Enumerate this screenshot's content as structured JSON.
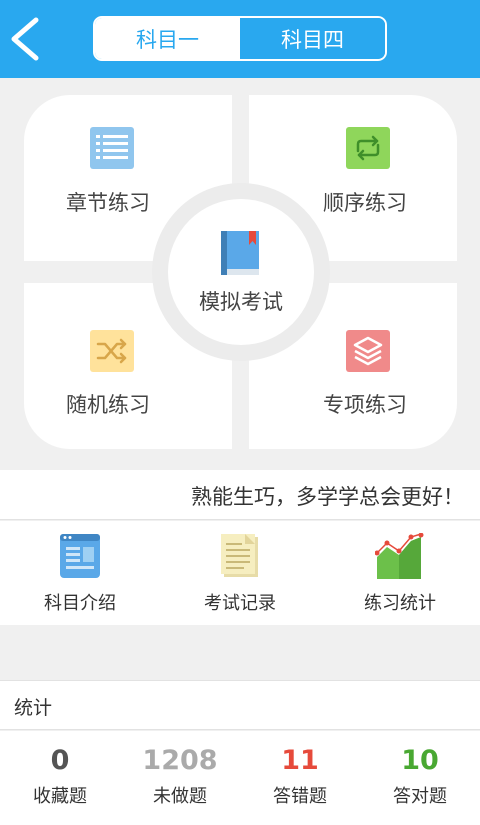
{
  "header": {
    "tabs": [
      {
        "label": "科目一",
        "active": true
      },
      {
        "label": "科目四",
        "active": false
      }
    ]
  },
  "practice": {
    "chapter": {
      "label": "章节练习",
      "icon": "list-icon",
      "color": "#90c6ee"
    },
    "sequential": {
      "label": "顺序练习",
      "icon": "loop-icon",
      "color": "#8fd65b"
    },
    "mock_exam": {
      "label": "模拟考试",
      "icon": "book-icon",
      "color": "#5aa8e8"
    },
    "random": {
      "label": "随机练习",
      "icon": "shuffle-icon",
      "color": "#ffe29b"
    },
    "special": {
      "label": "专项练习",
      "icon": "layers-icon",
      "color": "#f08a8a"
    }
  },
  "motto": "熟能生巧，多学学总会更好！",
  "tools": [
    {
      "label": "科目介绍",
      "icon": "document-icon"
    },
    {
      "label": "考试记录",
      "icon": "notepad-icon"
    },
    {
      "label": "练习统计",
      "icon": "stats-chart-icon"
    }
  ],
  "stats": {
    "title": "统计",
    "items": [
      {
        "value": "0",
        "label": "收藏题",
        "color": "#555555"
      },
      {
        "value": "1208",
        "label": "未做题",
        "color": "#aaaaaa"
      },
      {
        "value": "11",
        "label": "答错题",
        "color": "#e64a3b"
      },
      {
        "value": "10",
        "label": "答对题",
        "color": "#49a832"
      }
    ]
  },
  "colors": {
    "accent": "#29a8ef",
    "background": "#f0f0f0"
  }
}
